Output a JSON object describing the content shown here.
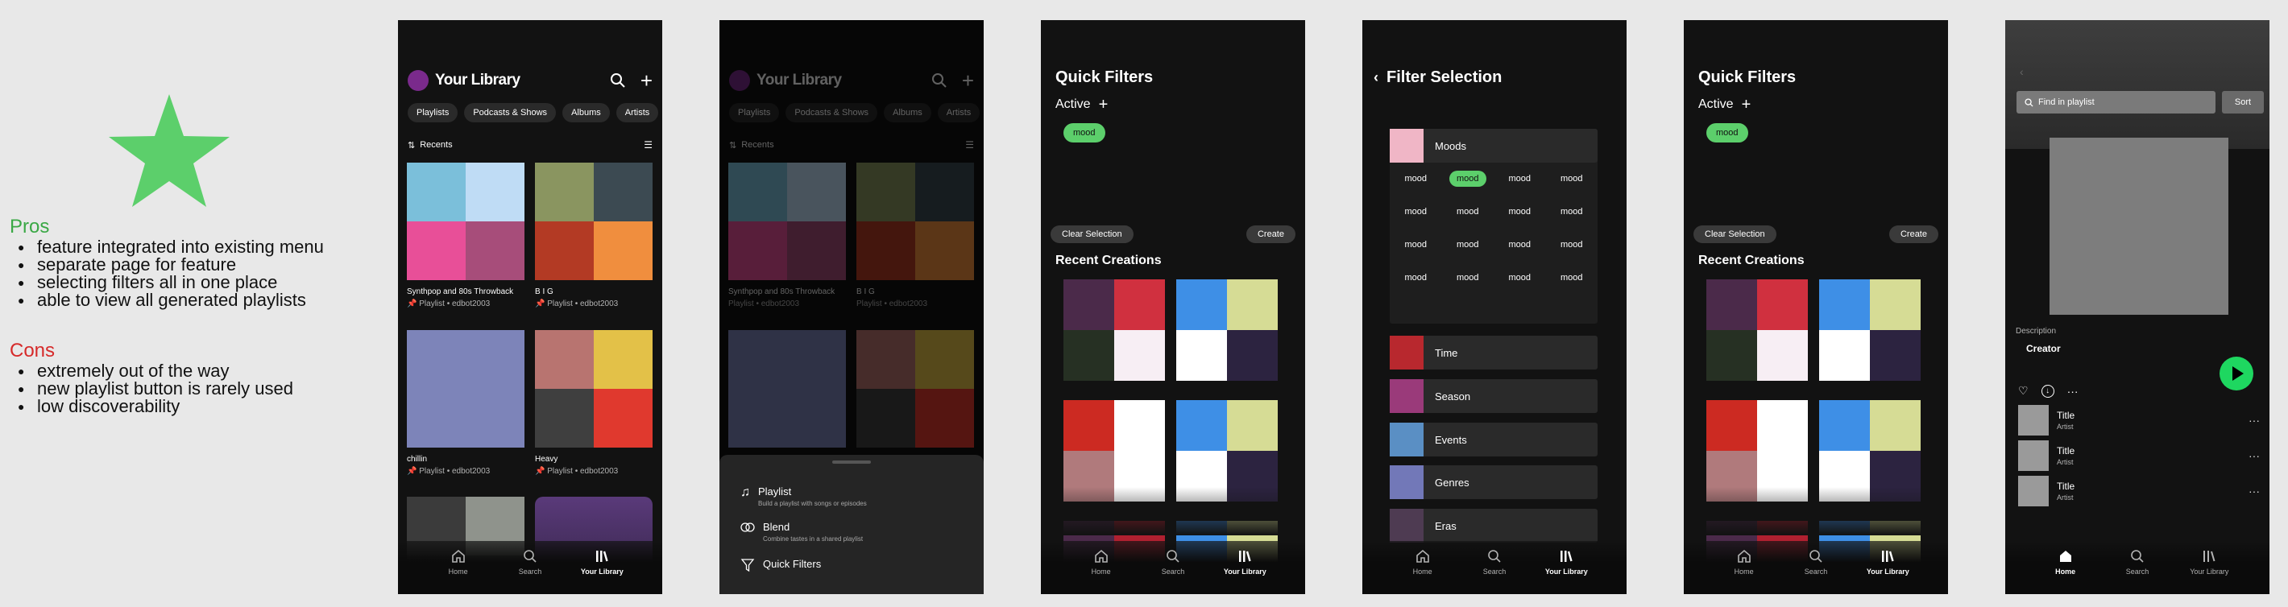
{
  "notes": {
    "pros_heading": "Pros",
    "pros": [
      "feature integrated into existing menu",
      "separate page for feature",
      "selecting filters all in one place",
      "able to view all generated playlists"
    ],
    "cons_heading": "Cons",
    "cons": [
      "extremely out of the way",
      "new playlist button is rarely used",
      "low discoverability"
    ]
  },
  "library": {
    "title": "Your Library",
    "chips": [
      "Playlists",
      "Podcasts & Shows",
      "Albums",
      "Artists"
    ],
    "recents_label": "Recents",
    "items": [
      {
        "title": "Synthpop and 80s Throwback",
        "sub": "Playlist • edbot2003"
      },
      {
        "title": "B I G",
        "sub": "Playlist • edbot2003"
      },
      {
        "title": "chillin",
        "sub": "Playlist • edbot2003"
      },
      {
        "title": "Heavy",
        "sub": "Playlist • edbot2003"
      }
    ]
  },
  "nav": {
    "home": "Home",
    "search": "Search",
    "library": "Your Library"
  },
  "sheet": {
    "items": [
      {
        "title": "Playlist",
        "desc": "Build a playlist with songs or episodes"
      },
      {
        "title": "Blend",
        "desc": "Combine tastes in a shared playlist"
      },
      {
        "title": "Quick Filters",
        "desc": ""
      }
    ]
  },
  "quick_filters": {
    "title": "Quick Filters",
    "active_label": "Active",
    "active_chip": "mood",
    "clear_label": "Clear Selection",
    "create_label": "Create",
    "recent_title": "Recent Creations"
  },
  "filter_selection": {
    "title": "Filter Selection",
    "moods_label": "Moods",
    "mood_chip": "mood",
    "categories": [
      "Time",
      "Season",
      "Events",
      "Genres",
      "Eras"
    ]
  },
  "playlist": {
    "find_placeholder": "Find in playlist",
    "sort_label": "Sort",
    "description_label": "Description",
    "creator_label": "Creator",
    "tracks": [
      {
        "title": "Title",
        "artist": "Artist"
      },
      {
        "title": "Title",
        "artist": "Artist"
      },
      {
        "title": "Title",
        "artist": "Artist"
      }
    ]
  },
  "colors": {
    "accent_green": "#5ccf6b",
    "spotify_green": "#1ed760",
    "cons_red": "#d62a2a",
    "background": "#121212"
  }
}
